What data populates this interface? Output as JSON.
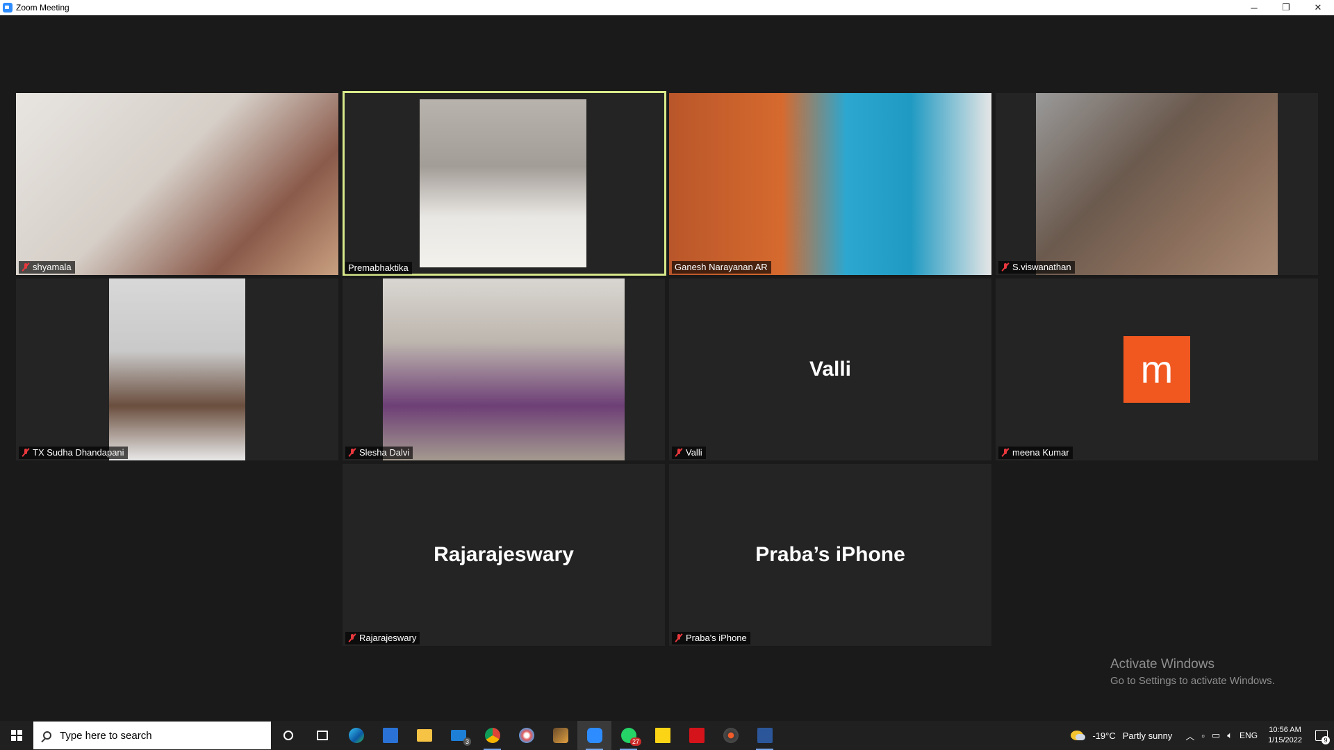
{
  "window": {
    "title": "Zoom Meeting",
    "minimize": "─",
    "restore": "❐",
    "close": "✕"
  },
  "participants": [
    {
      "name": "shyamala",
      "muted": true,
      "video": true
    },
    {
      "name": "Premabhaktika",
      "muted": false,
      "video": true,
      "active_speaker": true
    },
    {
      "name": "Ganesh Narayanan AR",
      "muted": false,
      "video": true
    },
    {
      "name": "S.viswanathan",
      "muted": true,
      "video": true
    },
    {
      "name": "TX Sudha Dhandapani",
      "muted": true,
      "video": true
    },
    {
      "name": "Slesha Dalvi",
      "muted": true,
      "video": true
    },
    {
      "name": "Valli",
      "muted": true,
      "video": false,
      "display_name": "Valli"
    },
    {
      "name": "meena Kumar",
      "muted": true,
      "video": false,
      "avatar_letter": "m",
      "avatar_color": "#f0581f"
    },
    {
      "name": "Rajarajeswary",
      "muted": true,
      "video": false,
      "display_name": "Rajarajeswary"
    },
    {
      "name": "Praba's iPhone",
      "muted": true,
      "video": false,
      "display_name": "Praba’s iPhone"
    }
  ],
  "watermark": {
    "line1": "Activate Windows",
    "line2": "Go to Settings to activate Windows."
  },
  "taskbar": {
    "search_placeholder": "Type here to search",
    "apps": [
      {
        "icon": "cortana-icon"
      },
      {
        "icon": "task-view-icon"
      },
      {
        "icon": "edge-icon"
      },
      {
        "icon": "store-icon"
      },
      {
        "icon": "file-explorer-icon"
      },
      {
        "icon": "mail-icon",
        "badge": "3"
      },
      {
        "icon": "chrome-icon"
      },
      {
        "icon": "paint-icon"
      },
      {
        "icon": "app-icon"
      },
      {
        "icon": "zoom-icon",
        "active": true
      },
      {
        "icon": "whatsapp-icon",
        "badge": "27"
      },
      {
        "icon": "sticky-notes-icon"
      },
      {
        "icon": "acrobat-icon"
      },
      {
        "icon": "media-player-icon"
      },
      {
        "icon": "word-icon"
      }
    ],
    "weather": {
      "temp": "-19°C",
      "condition": "Partly sunny"
    },
    "language": "ENG",
    "time": "10:56 AM",
    "date": "1/15/2022",
    "notifications": "9"
  },
  "colors": {
    "accent": "#2d8cff",
    "active_speaker_border": "#d8e98a",
    "muted": "#e8383d"
  }
}
